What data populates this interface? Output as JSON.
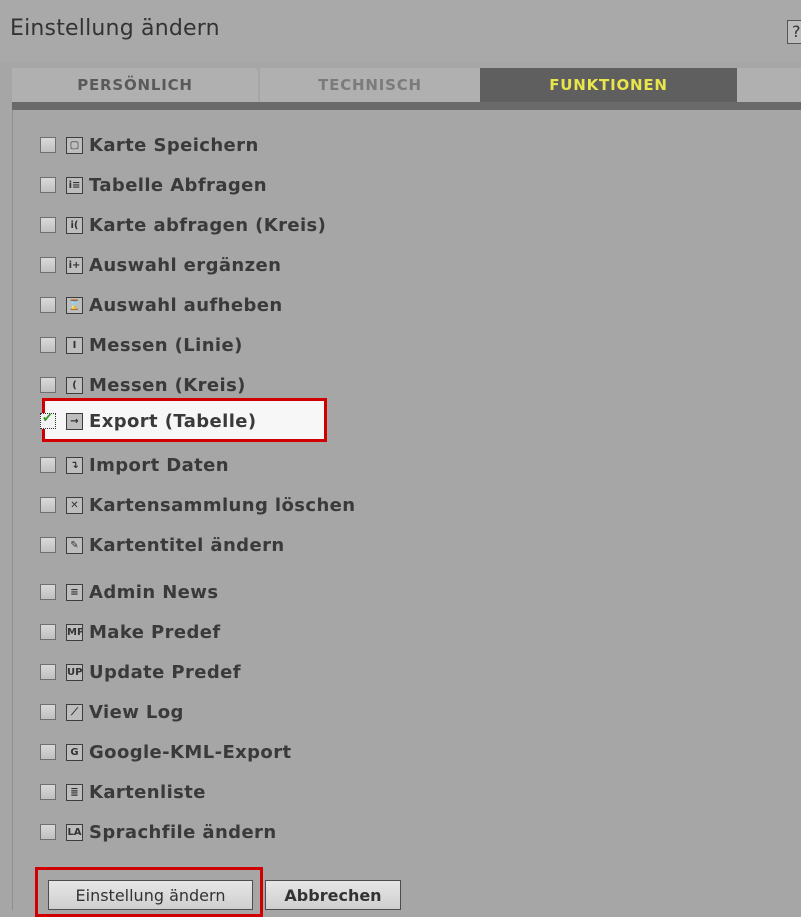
{
  "header": {
    "title": "Einstellung ändern",
    "help": "?"
  },
  "tabs": [
    {
      "label": "PERSÖNLICH"
    },
    {
      "label": "TECHNISCH"
    },
    {
      "label": "FUNKTIONEN"
    }
  ],
  "functions": [
    {
      "label": "Karte Speichern",
      "icon": "save-icon",
      "glyph": "▢",
      "checked": false
    },
    {
      "label": "Tabelle Abfragen",
      "icon": "table-query-icon",
      "glyph": "i≡",
      "checked": false
    },
    {
      "label": "Karte abfragen (Kreis)",
      "icon": "circle-query-icon",
      "glyph": "i(",
      "checked": false
    },
    {
      "label": "Auswahl ergänzen",
      "icon": "add-selection-icon",
      "glyph": "i+",
      "checked": false
    },
    {
      "label": "Auswahl aufheben",
      "icon": "clear-selection-icon",
      "glyph": "⌛",
      "checked": false
    },
    {
      "label": "Messen (Linie)",
      "icon": "measure-line-icon",
      "glyph": "I",
      "checked": false
    },
    {
      "label": "Messen (Kreis)",
      "icon": "measure-circle-icon",
      "glyph": "(",
      "checked": false
    },
    {
      "label": "Export (Tabelle)",
      "icon": "export-icon",
      "glyph": "→",
      "checked": true
    },
    {
      "label": "Import Daten",
      "icon": "import-icon",
      "glyph": "↴",
      "checked": false
    },
    {
      "label": "Kartensammlung löschen",
      "icon": "delete-icon",
      "glyph": "✕",
      "checked": false
    },
    {
      "label": "Kartentitel ändern",
      "icon": "pencil-icon",
      "glyph": "✎",
      "checked": false
    },
    {
      "label": "Admin News",
      "icon": "news-icon",
      "glyph": "≡",
      "checked": false
    },
    {
      "label": "Make Predef",
      "icon": "make-predef-icon",
      "glyph": "MP",
      "checked": false
    },
    {
      "label": "Update Predef",
      "icon": "update-predef-icon",
      "glyph": "UP",
      "checked": false
    },
    {
      "label": "View Log",
      "icon": "log-chart-icon",
      "glyph": "⟋",
      "checked": false
    },
    {
      "label": "Google-KML-Export",
      "icon": "google-kml-icon",
      "glyph": "G",
      "checked": false
    },
    {
      "label": "Kartenliste",
      "icon": "list-icon",
      "glyph": "≣",
      "checked": false
    },
    {
      "label": "Sprachfile ändern",
      "icon": "language-icon",
      "glyph": "LA",
      "checked": false
    }
  ],
  "buttons": {
    "save": "Einstellung ändern",
    "cancel": "Abbrechen"
  },
  "colors": {
    "highlight": "#d00000",
    "active_tab_bg": "#5f5f5f",
    "active_tab_text": "#e8e64a"
  }
}
